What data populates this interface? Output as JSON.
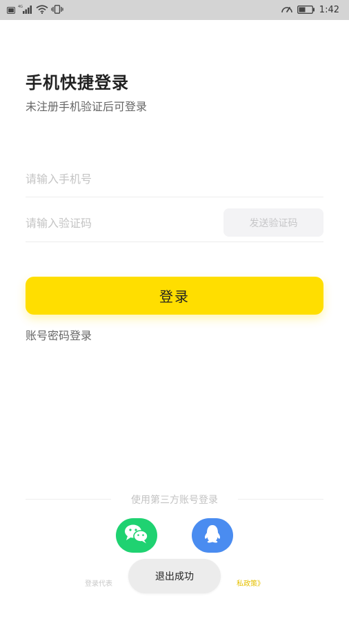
{
  "status_bar": {
    "network_badge": "HD",
    "network_type": "4G",
    "battery_level": 0.5,
    "time": "1:42"
  },
  "login": {
    "title": "手机快捷登录",
    "subtitle": "未注册手机验证后可登录",
    "phone_placeholder": "请输入手机号",
    "code_placeholder": "请输入验证码",
    "send_code_label": "发送验证码",
    "login_button_label": "登录",
    "password_login_link": "账号密码登录"
  },
  "third_party": {
    "divider_text": "使用第三方账号登录",
    "options": [
      "wechat-icon",
      "qq-icon"
    ]
  },
  "agreement": {
    "prefix": "登录代表",
    "suffix": "私政策》"
  },
  "toast": {
    "message": "退出成功"
  },
  "colors": {
    "accent": "#ffde00",
    "wechat": "#1fd271",
    "qq": "#4a8cf0",
    "status_bar": "#d4d4d4"
  }
}
